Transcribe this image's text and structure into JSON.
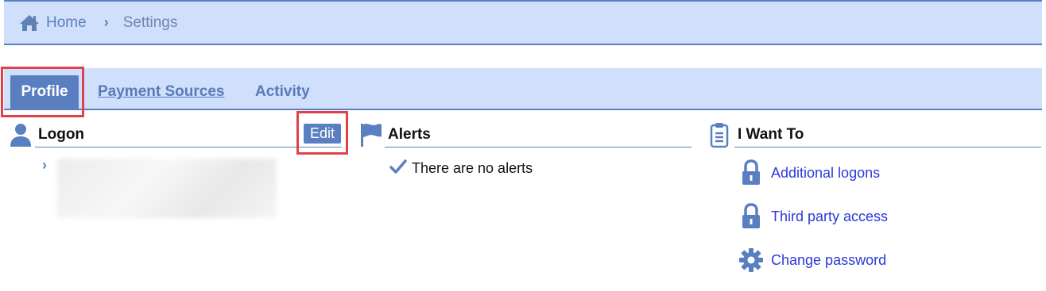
{
  "breadcrumb": {
    "home_label": "Home",
    "separator": "›",
    "current": "Settings"
  },
  "tabs": [
    {
      "label": "Profile",
      "active": true
    },
    {
      "label": "Payment Sources",
      "active": false
    },
    {
      "label": "Activity",
      "active": false
    }
  ],
  "logon": {
    "title": "Logon",
    "edit_label": "Edit",
    "chevron": "›"
  },
  "alerts": {
    "title": "Alerts",
    "empty_text": "There are no alerts"
  },
  "i_want_to": {
    "title": "I Want To",
    "items": [
      {
        "label": "Additional logons",
        "icon": "lock-icon"
      },
      {
        "label": "Third party access",
        "icon": "lock-icon"
      },
      {
        "label": "Change password",
        "icon": "gear-icon"
      }
    ]
  },
  "colors": {
    "bar_background": "#cfdffc",
    "accent": "#5a7fc1",
    "link": "#2b39d8",
    "highlight": "#e0414b"
  }
}
